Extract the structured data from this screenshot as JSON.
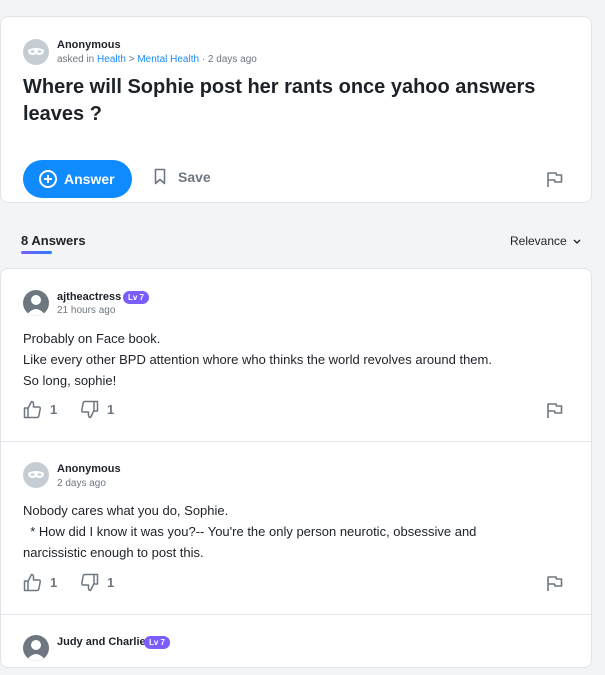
{
  "question": {
    "author": "Anonymous",
    "asked_prefix": "asked in",
    "category": "Health",
    "separator": ">",
    "subcategory": "Mental Health",
    "time": "· 2 days ago",
    "title": "Where will Sophie post her rants once yahoo answers leaves ?",
    "answer_label": "Answer",
    "save_label": "Save"
  },
  "answers_header": {
    "count_label": "8 Answers",
    "sort_label": "Relevance"
  },
  "answers": [
    {
      "author": "ajtheactress",
      "level": "Lv 7",
      "time": "21 hours ago",
      "lines": [
        "Probably on Face book.",
        "Like every other BPD attention whore who thinks the world revolves around them.",
        "So long, sophie!"
      ],
      "upvotes": "1",
      "downvotes": "1"
    },
    {
      "author": "Anonymous",
      "time": "2 days ago",
      "lines": [
        "Nobody cares what you do, Sophie.",
        "  * How did I know it was you?-- You're the only person neurotic, obsessive and",
        "narcissistic enough to post this."
      ],
      "upvotes": "1",
      "downvotes": "1"
    },
    {
      "author": "Judy and Charlie",
      "level": "Lv 7"
    }
  ],
  "colors": {
    "accent": "#0f8bff",
    "level_badge": "#7b5cff",
    "link": "#1a8cff",
    "muted": "#6e7780"
  }
}
